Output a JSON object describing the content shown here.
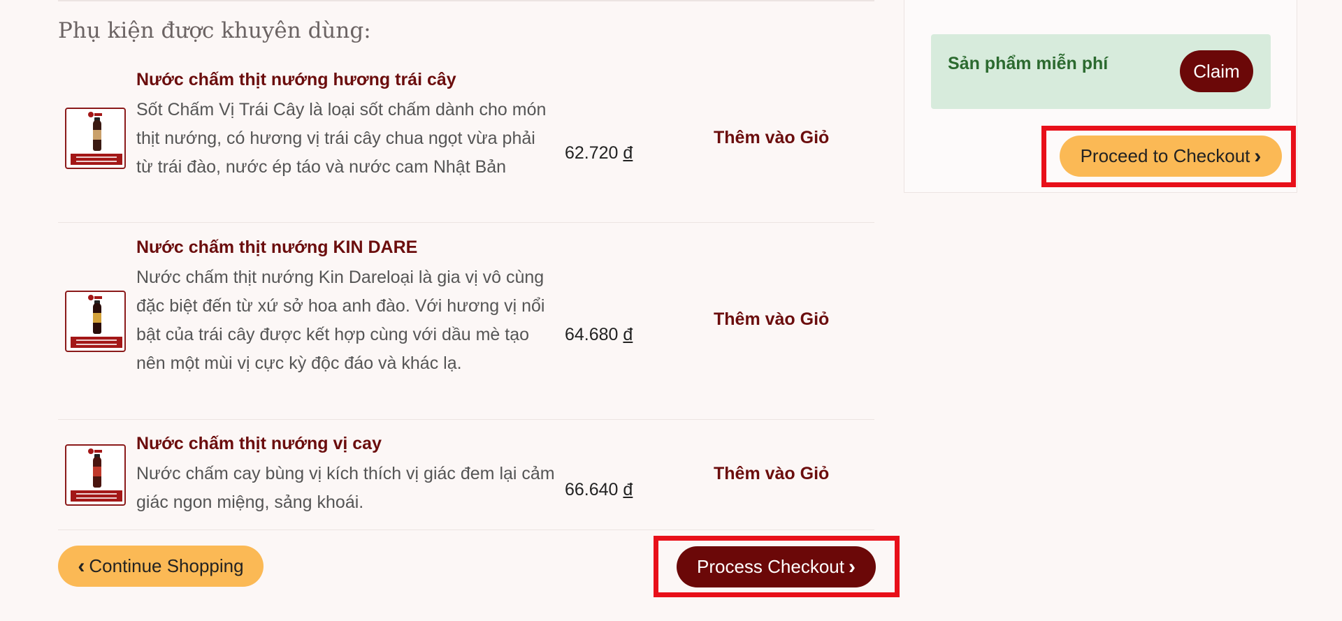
{
  "recommended": {
    "title": "Phụ kiện được khuyên dùng:",
    "items": [
      {
        "name": "Nước chấm thịt nướng hương trái cây",
        "desc": "Sốt Chấm Vị Trái Cây là loại sốt chấm dành cho món thịt nướng, có hương vị trái cây chua ngọt vừa phải từ trái đào, nước ép táo và nước cam Nhật Bản",
        "price": "62.720",
        "currency": "đ",
        "add_label": "Thêm vào Giỏ",
        "bottle_color": "#3a1a12",
        "label_color": "#c9a06a"
      },
      {
        "name": "Nước chấm thịt nướng KIN DARE",
        "desc": "Nước chấm thịt nướng Kin Dareloại là gia vị vô cùng đặc biệt đến từ xứ sở hoa anh đào. Với hương vị nổi bật của trái cây được kết hợp cùng với dầu mè tạo nên một mùi vị cực kỳ độc đáo và khác lạ.",
        "price": "64.680",
        "currency": "đ",
        "add_label": "Thêm vào Giỏ",
        "bottle_color": "#2a0d0a",
        "label_color": "#d4a23a"
      },
      {
        "name": "Nước chấm thịt nướng vị cay",
        "desc": "Nước chấm cay bùng vị kích thích vị giác đem lại cảm giác ngon miệng, sảng khoái.",
        "price": "66.640",
        "currency": "đ",
        "add_label": "Thêm vào Giỏ",
        "bottle_color": "#4a150f",
        "label_color": "#c0392b"
      }
    ]
  },
  "sidebar": {
    "free_product_label": "Sản phẩm miễn phí",
    "claim_label": "Claim",
    "proceed_label": "Proceed to Checkout"
  },
  "footer": {
    "continue_label": "Continue Shopping",
    "process_label": "Process Checkout"
  },
  "colors": {
    "brand": "#6b0808",
    "gold": "#fbb955",
    "highlight": "#e8101a"
  }
}
